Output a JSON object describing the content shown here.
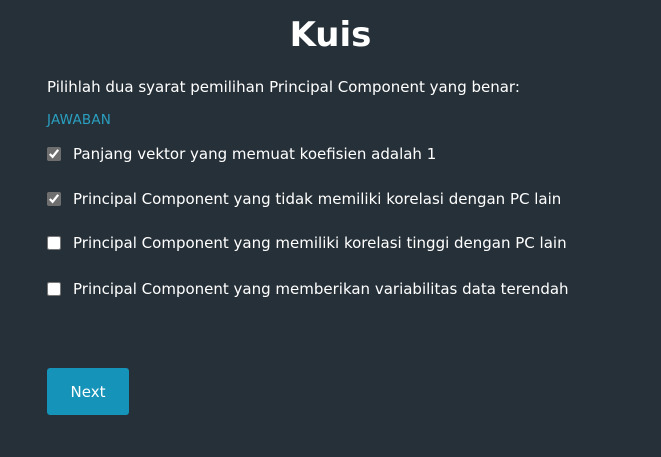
{
  "quiz": {
    "title": "Kuis",
    "question": "Pilihlah dua syarat pemilihan Principal Component yang benar:",
    "answer_label": "JAWABAN",
    "options": [
      {
        "label": "Panjang vektor yang memuat koefisien adalah 1",
        "checked": true
      },
      {
        "label": "Principal Component yang tidak memiliki korelasi dengan PC lain",
        "checked": true
      },
      {
        "label": "Principal Component yang memiliki korelasi tinggi dengan PC lain",
        "checked": false
      },
      {
        "label": "Principal Component yang memberikan variabilitas data terendah",
        "checked": false
      }
    ],
    "next_label": "Next"
  },
  "colors": {
    "background": "#263038",
    "accent": "#1693b8",
    "answer_label": "#2a9fc0",
    "text": "#ffffff"
  }
}
